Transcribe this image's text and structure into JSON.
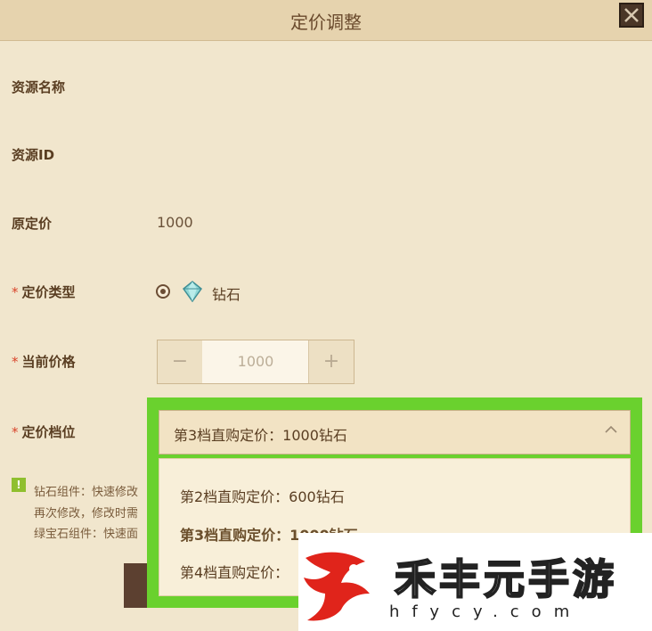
{
  "dialog": {
    "title": "定价调整",
    "close_icon": "close-icon"
  },
  "form": {
    "resource_name_label": "资源名称",
    "resource_id_label": "资源ID",
    "original_price_label": "原定价",
    "original_price_value": "1000",
    "required_mark": "*",
    "pricing_type_label": "定价类型",
    "pricing_type_option": "钻石",
    "pricing_type_icon": "diamond-icon",
    "current_price_label": "当前价格",
    "current_price_value": "1000",
    "minus_symbol": "−",
    "plus_symbol": "+",
    "price_tier_label": "定价档位"
  },
  "tier_select": {
    "selected": "第3档直购定价：1000钻石",
    "options": [
      "第2档直购定价：600钻石",
      "第3档直购定价：1000钻石",
      "第4档直购定价："
    ]
  },
  "notice": {
    "icon": "!",
    "lines": [
      "钻石组件：快速修改",
      "再次修改，修改时需",
      "绿宝石组件：快速面"
    ]
  },
  "watermark": {
    "text": "禾丰元手游",
    "url": "hfycy.com"
  },
  "colors": {
    "highlight": "#6ad12e",
    "accent_star": "#d9442a",
    "background": "#f1e6cd"
  }
}
